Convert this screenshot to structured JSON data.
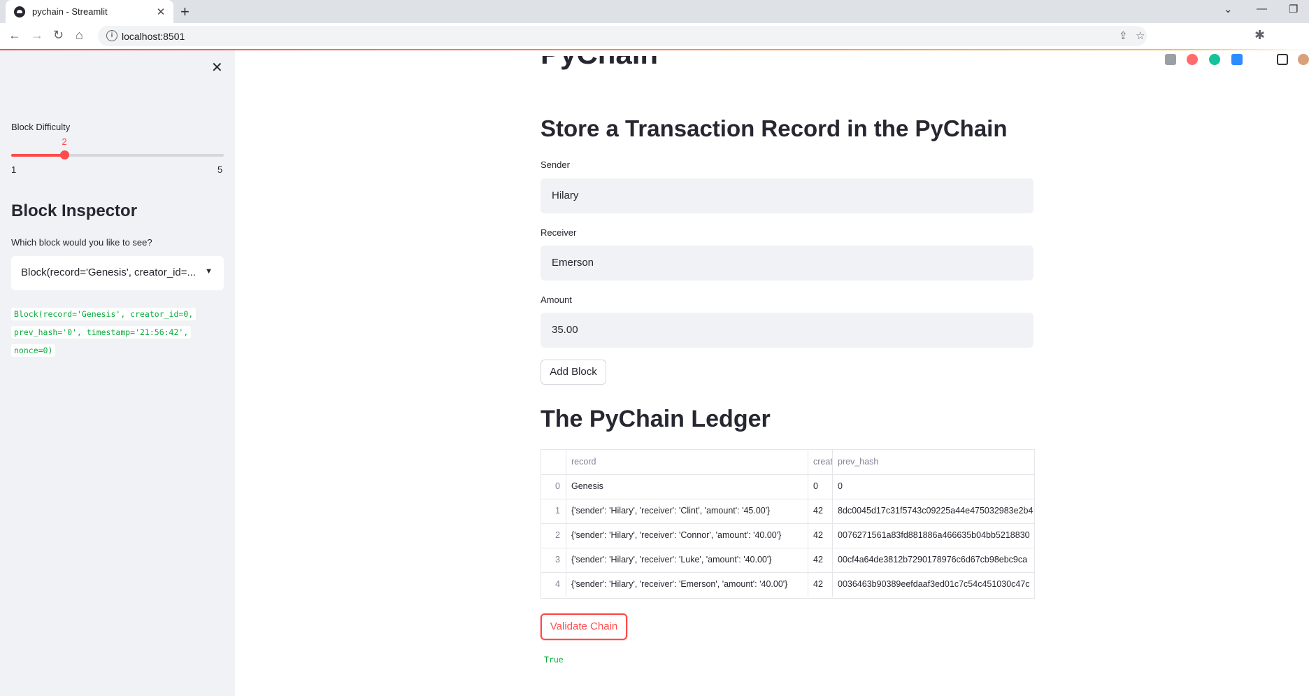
{
  "browser": {
    "tab_title": "pychain - Streamlit",
    "tab_close": "✕",
    "new_tab": "+",
    "url": "localhost:8501",
    "info_icon": "i"
  },
  "sidebar": {
    "close": "✕",
    "slider": {
      "label": "Block Difficulty",
      "value": "2",
      "min": "1",
      "max": "5",
      "fraction": 0.25
    },
    "inspector_title": "Block Inspector",
    "select_label": "Which block would you like to see?",
    "select_value": "Block(record='Genesis', creator_id=...",
    "code_lines": [
      "Block(record='Genesis', creator_id=0,",
      "prev_hash='0', timestamp='21:56:42',",
      "nonce=0)"
    ]
  },
  "main": {
    "title_partial": "PyChain",
    "store_heading": "Store a Transaction Record in the PyChain",
    "sender_label": "Sender",
    "sender_value": "Hilary",
    "receiver_label": "Receiver",
    "receiver_value": "Emerson",
    "amount_label": "Amount",
    "amount_value": "35.00",
    "add_block_button": "Add Block",
    "ledger_heading": "The PyChain Ledger",
    "table": {
      "headers": [
        "",
        "record",
        "creat",
        "prev_hash"
      ],
      "rows": [
        [
          "0",
          "Genesis",
          "0",
          "0"
        ],
        [
          "1",
          "{'sender': 'Hilary', 'receiver': 'Clint', 'amount': '45.00'}",
          "42",
          "8dc0045d17c31f5743c09225a44e475032983e2b4"
        ],
        [
          "2",
          "{'sender': 'Hilary', 'receiver': 'Connor', 'amount': '40.00'}",
          "42",
          "0076271561a83fd881886a466635b04bb5218830"
        ],
        [
          "3",
          "{'sender': 'Hilary', 'receiver': 'Luke', 'amount': '40.00'}",
          "42",
          "00cf4a64de3812b7290178976c6d67cb98ebc9ca"
        ],
        [
          "4",
          "{'sender': 'Hilary', 'receiver': 'Emerson', 'amount': '40.00'}",
          "42",
          "0036463b90389eefdaaf3ed01c7c54c451030c47c"
        ]
      ]
    },
    "validate_button": "Validate Chain",
    "validate_result": "True"
  },
  "colors": {
    "accent": "#ff4b4b",
    "code_green": "#09ab3b",
    "sidebar_bg": "#f0f2f6"
  },
  "icons": [
    "streamlit-icon",
    "back-icon",
    "forward-icon",
    "reload-icon",
    "home-icon",
    "share-icon",
    "star-icon",
    "extensions-icon",
    "profile-icon"
  ]
}
